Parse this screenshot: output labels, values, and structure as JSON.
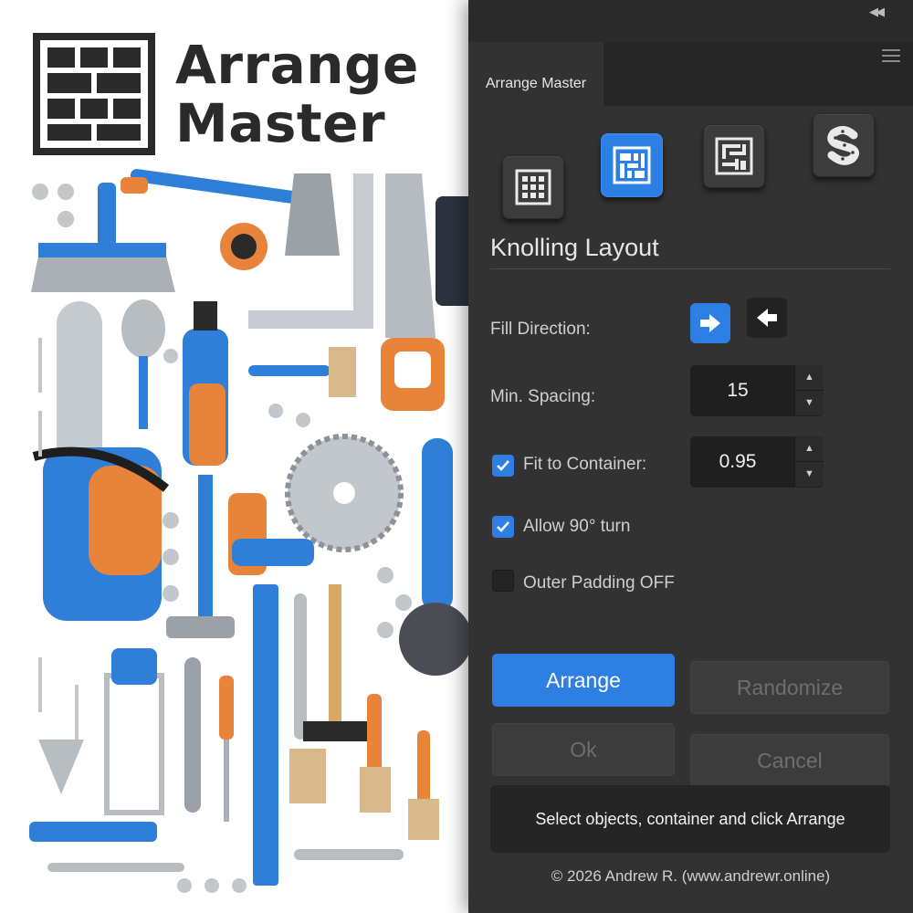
{
  "brand": {
    "title_line1": "Arrange",
    "title_line2": "Master"
  },
  "panel": {
    "tab_label": "Arrange Master",
    "modes": [
      {
        "name": "grid-layout",
        "icon": "grid-icon",
        "active": false
      },
      {
        "name": "masonry-layout",
        "icon": "masonry-grid-icon",
        "active": true
      },
      {
        "name": "knolling-layout",
        "icon": "maze-icon",
        "active": false
      },
      {
        "name": "path-layout",
        "icon": "s-path-icon",
        "active": false
      }
    ],
    "section_title": "Knolling Layout",
    "fill_direction": {
      "label": "Fill Direction:",
      "selected": "right"
    },
    "min_spacing": {
      "label": "Min. Spacing:",
      "value": "15"
    },
    "fit_to_container": {
      "label": "Fit to Container:",
      "checked": true,
      "value": "0.95"
    },
    "allow_turn": {
      "label": "Allow 90° turn",
      "checked": true
    },
    "outer_padding": {
      "label": "Outer Padding OFF",
      "checked": false
    },
    "buttons": {
      "arrange": "Arrange",
      "randomize": "Randomize",
      "ok": "Ok",
      "cancel": "Cancel"
    },
    "status": "Select objects, container and click Arrange",
    "copyright": "© 2026 Andrew R. (www.andrewr.online)"
  },
  "colors": {
    "accent": "#2d7fe3",
    "panel_bg": "#323232",
    "tool_blue": "#2f7fd8",
    "tool_orange": "#e8843a"
  }
}
